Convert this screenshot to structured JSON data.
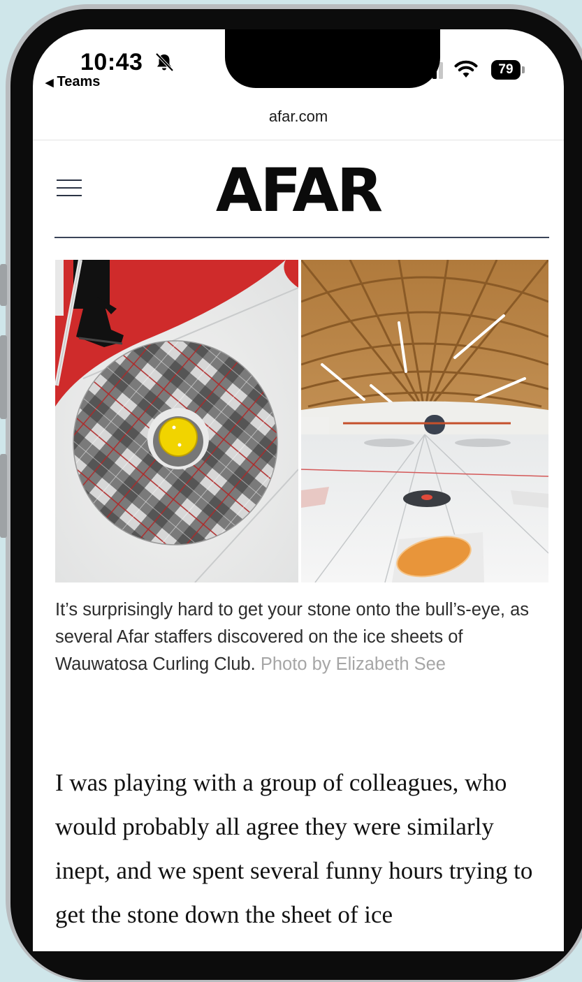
{
  "status_bar": {
    "time": "10:43",
    "back_app": "Teams",
    "battery": "79",
    "icons": [
      "bell-slash-icon",
      "signal-icon",
      "wifi-icon",
      "battery-icon"
    ]
  },
  "browser": {
    "url": "afar.com"
  },
  "site": {
    "logo": "AFAR",
    "menu_icon": "hamburger-menu-icon"
  },
  "article": {
    "images": [
      "curling-house-photo",
      "curling-rink-photo"
    ],
    "caption": "It’s surprisingly hard to get your stone onto the bull’s-eye, as several Afar staffers discovered on the ice sheets of Wauwatosa Curling Club.",
    "photo_credit": "Photo by Elizabeth See",
    "body": "I was playing with a group of colleagues, who would probably all agree they were similarly inept, and we spent several funny hours trying to get the stone down the sheet of ice"
  },
  "colors": {
    "background": "#cfe6ea",
    "header_rule": "#3a4458",
    "credit": "#a6a6a6"
  }
}
